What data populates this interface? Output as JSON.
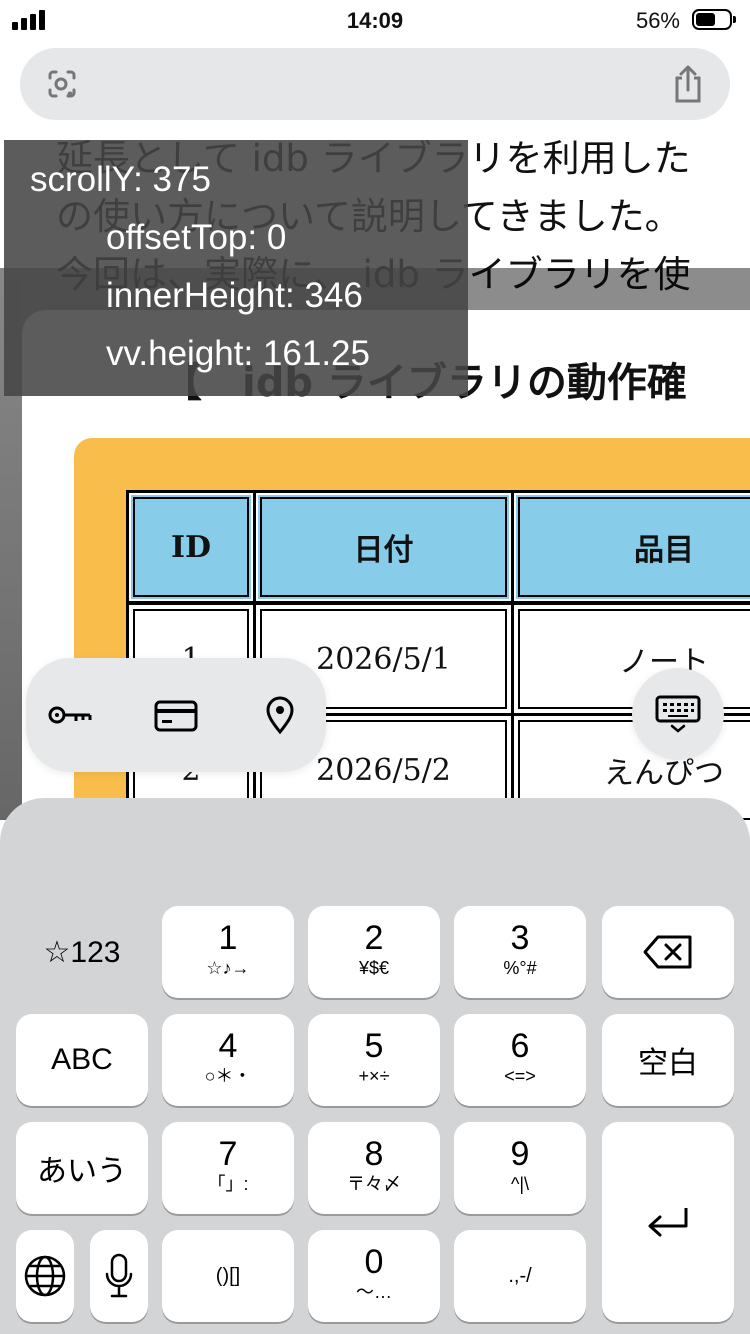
{
  "status_bar": {
    "time": "14:09",
    "battery_percent": "56%"
  },
  "article": {
    "lines": [
      "延長として idb ライブラリを利用した",
      "の使い方について説明してきました。",
      "今回は、実際に、 idb ライブラリを使"
    ]
  },
  "figure": {
    "title": "【　idb ライブラリの動作確",
    "table": {
      "headers": [
        "ID",
        "日付",
        "品目"
      ],
      "rows": [
        [
          "1",
          "2026/5/1",
          "ノート"
        ],
        [
          "2",
          "2026/5/2",
          "えんぴつ"
        ]
      ]
    }
  },
  "debug": {
    "scroll_y": "scrollY: 375",
    "offset_top": "offsetTop: 0",
    "inner_height": "innerHeight: 346",
    "vv_height": "vv.height: 161.25"
  },
  "keyboard": {
    "symbols_key": "☆123",
    "abc_key": "ABC",
    "kana_key": "あいう",
    "space_key": "空白",
    "keys": [
      {
        "num": "1",
        "sub": "☆♪→"
      },
      {
        "num": "2",
        "sub": "¥$€"
      },
      {
        "num": "3",
        "sub": "%°#"
      },
      {
        "num": "4",
        "sub": "○＊・"
      },
      {
        "num": "5",
        "sub": "+×÷"
      },
      {
        "num": "6",
        "sub": "<=>"
      },
      {
        "num": "7",
        "sub": "「」:"
      },
      {
        "num": "8",
        "sub": "〒々〆"
      },
      {
        "num": "9",
        "sub": "^|\\"
      },
      {
        "num": "0",
        "sub": "〜…"
      }
    ],
    "brackets_key": "()[]",
    "punct_key": ".,-/"
  },
  "colors": {
    "table_header": "#87cde9",
    "figure_frame": "#f9bd4b",
    "keyboard_bg": "#d3d4d6"
  }
}
